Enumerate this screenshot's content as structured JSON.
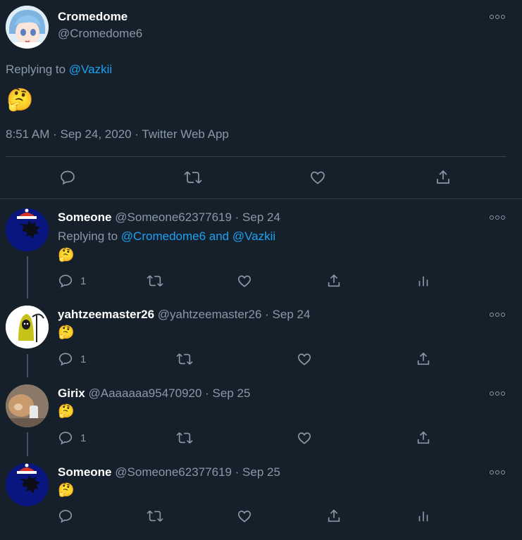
{
  "main_tweet": {
    "name": "Cromedome",
    "handle": "@Cromedome6",
    "replying_prefix": "Replying to",
    "replying_to": "@Vazkii",
    "emoji": "🤔",
    "timestamp": "8:51 AM · Sep 24, 2020 · Twitter Web App"
  },
  "replies": [
    {
      "name": "Someone",
      "meta": "@Someone62377619 · Sep 24",
      "replying_prefix": "Replying to",
      "replying_to": "@Cromedome6 and @Vazkii",
      "emoji": "🤔",
      "reply_count": "1"
    },
    {
      "name": "yahtzeemaster26",
      "meta": "@yahtzeemaster26 · Sep 24",
      "emoji": "🤔",
      "reply_count": "1"
    },
    {
      "name": "Girix",
      "meta": "@Aaaaaaa95470920 · Sep 25",
      "emoji": "🤔",
      "reply_count": "1"
    },
    {
      "name": "Someone",
      "meta": "@Someone62377619 · Sep 25",
      "emoji": "🤔"
    }
  ],
  "icons": [
    "reply-icon",
    "retweet-icon",
    "like-icon",
    "share-icon",
    "analytics-icon",
    "more-icon"
  ],
  "colors": {
    "background": "#15202b",
    "muted": "#8899a6",
    "link": "#1da1f2",
    "divider": "#38444d"
  }
}
